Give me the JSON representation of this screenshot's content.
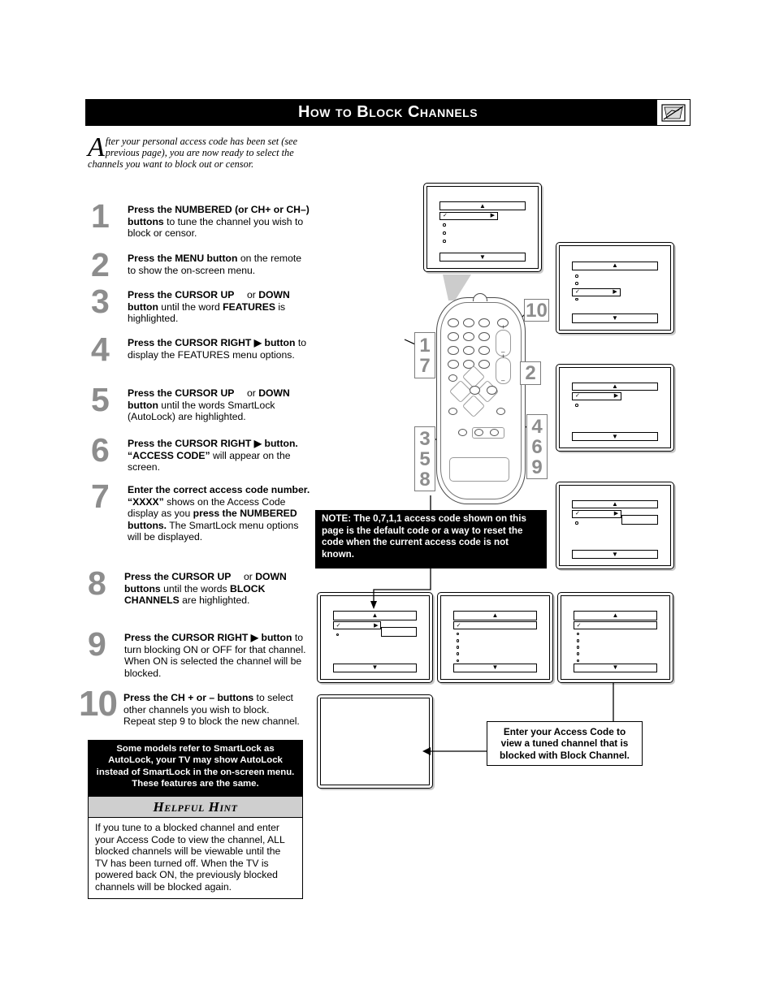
{
  "header": {
    "title": "How to Block Channels",
    "icon": "blocked-tv-icon"
  },
  "intro": {
    "dropcap": "A",
    "text": "fter your personal access code has been set (see previous page), you are now ready to select the channels you want to block out or censor."
  },
  "steps": [
    {
      "num": "1",
      "parts": [
        {
          "t": "Press the NUMBERED (or CH+ or CH–) buttons",
          "b": true
        },
        {
          "t": " to tune the channel you wish to block or censor.",
          "b": false
        }
      ]
    },
    {
      "num": "2",
      "parts": [
        {
          "t": "Press the MENU button",
          "b": true
        },
        {
          "t": " on the remote to show the on-screen menu.",
          "b": false
        }
      ]
    },
    {
      "num": "3",
      "parts": [
        {
          "t": "Press the CURSOR UP",
          "b": true
        },
        {
          "t": "  or ",
          "b": false
        },
        {
          "t": "DOWN",
          "b": true
        },
        {
          "t": "  ",
          "b": false
        },
        {
          "t": "button",
          "b": true
        },
        {
          "t": " until the word ",
          "b": false
        },
        {
          "t": "FEATURES",
          "b": true
        },
        {
          "t": " is highlighted.",
          "b": false
        }
      ]
    },
    {
      "num": "4",
      "parts": [
        {
          "t": "Press the CURSOR RIGHT ▶",
          "b": true
        },
        {
          "t": " ",
          "b": false
        },
        {
          "t": "button",
          "b": true
        },
        {
          "t": " to display the FEATURES menu options.",
          "b": false
        }
      ]
    },
    {
      "num": "5",
      "parts": [
        {
          "t": "Press the CURSOR UP",
          "b": true
        },
        {
          "t": "  or ",
          "b": false
        },
        {
          "t": "DOWN",
          "b": true
        },
        {
          "t": "  ",
          "b": false
        },
        {
          "t": "button",
          "b": true
        },
        {
          "t": " until the words SmartLock (AutoLock) are highlighted.",
          "b": false
        }
      ]
    },
    {
      "num": "6",
      "parts": [
        {
          "t": "Press the CURSOR RIGHT ▶ button. “ACCESS CODE”",
          "b": true
        },
        {
          "t": " will appear on the screen.",
          "b": false
        }
      ]
    },
    {
      "num": "7",
      "parts": [
        {
          "t": "Enter the correct access code number. “XXXX”",
          "b": true
        },
        {
          "t": " shows on the Access Code display as you ",
          "b": false
        },
        {
          "t": "press the NUMBERED buttons.",
          "b": true
        },
        {
          "t": " The SmartLock menu options will be displayed.",
          "b": false
        }
      ]
    },
    {
      "num": "8",
      "parts": [
        {
          "t": "Press the CURSOR UP",
          "b": true
        },
        {
          "t": "  or ",
          "b": false
        },
        {
          "t": "DOWN",
          "b": true
        },
        {
          "t": "  ",
          "b": false
        },
        {
          "t": "buttons",
          "b": true
        },
        {
          "t": " until the words ",
          "b": false
        },
        {
          "t": "BLOCK CHANNELS",
          "b": true
        },
        {
          "t": " are highlighted.",
          "b": false
        }
      ]
    },
    {
      "num": "9",
      "parts": [
        {
          "t": "Press the CURSOR RIGHT ▶",
          "b": true
        },
        {
          "t": " ",
          "b": false
        },
        {
          "t": "button",
          "b": true
        },
        {
          "t": " to turn blocking ON or OFF for that channel. When ON is selected the channel will be blocked.",
          "b": false
        }
      ]
    },
    {
      "num": "10",
      "parts": [
        {
          "t": "Press the CH + or – buttons",
          "b": true
        },
        {
          "t": " to select other channels you wish to block. Repeat step 9 to block the new channel.",
          "b": false
        }
      ]
    }
  ],
  "smartlock_note": "Some models refer to SmartLock as AutoLock, your TV may show AutoLock instead of SmartLock in the on-screen menu. These features are the same.",
  "hint": {
    "heading": "Helpful Hint",
    "body": "If you tune to a blocked channel and enter your Access Code to view the channel, ALL blocked channels will be viewable until the TV has been turned off. When the TV is powered back ON, the previously blocked channels will be blocked again."
  },
  "note_box": {
    "label": "NOTE:",
    "text": " The 0,7,1,1 access code shown on this page is the default code or a way to reset the code when the current access code is not known."
  },
  "access_callout": "Enter your Access Code to view a tuned channel that is blocked with Block Channel.",
  "remote_callouts": [
    {
      "name": "callout-1-7",
      "values": [
        "1",
        "7"
      ]
    },
    {
      "name": "callout-10",
      "values": [
        "10"
      ]
    },
    {
      "name": "callout-2",
      "values": [
        "2"
      ]
    },
    {
      "name": "callout-4-6-9",
      "values": [
        "4",
        "6",
        "9"
      ]
    },
    {
      "name": "callout-3-5-8",
      "values": [
        "3",
        "5",
        "8"
      ]
    }
  ],
  "screen_glyphs": {
    "up": "▲",
    "down": "▼",
    "right": "▶",
    "check": "✓"
  },
  "plus_minus": {
    "plus": "+",
    "minus": "–"
  }
}
